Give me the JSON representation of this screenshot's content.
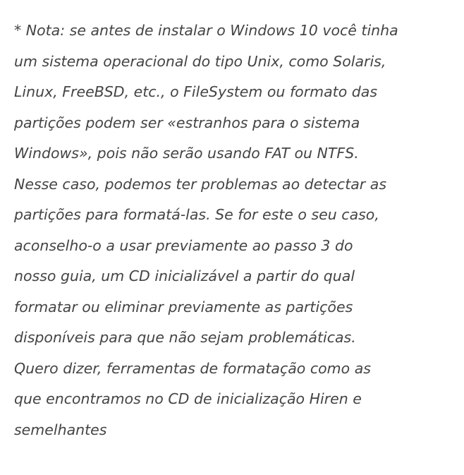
{
  "note": {
    "lines": [
      "* Nota: se antes de instalar o Windows 10 você tinha",
      "um sistema operacional do tipo Unix, como Solaris,",
      "Linux, FreeBSD, etc., o FileSystem ou formato das",
      "partições podem ser «estranhos para o sistema",
      "Windows», pois não serão usando FAT ou NTFS.",
      "Nesse caso, podemos ter problemas ao detectar as",
      "partições para formatá-las. Se for este o seu caso,",
      "aconselho-o a usar previamente ao passo 3 do",
      "nosso guia, um CD inicializável a partir do qual",
      "formatar ou eliminar previamente as partições",
      "disponíveis para que não sejam problemáticas.",
      "Quero dizer, ferramentas de formatação como as",
      "que encontramos no CD de inicialização Hiren e",
      "semelhantes"
    ]
  },
  "colors": {
    "text": "#444444",
    "background": "#ffffff"
  }
}
